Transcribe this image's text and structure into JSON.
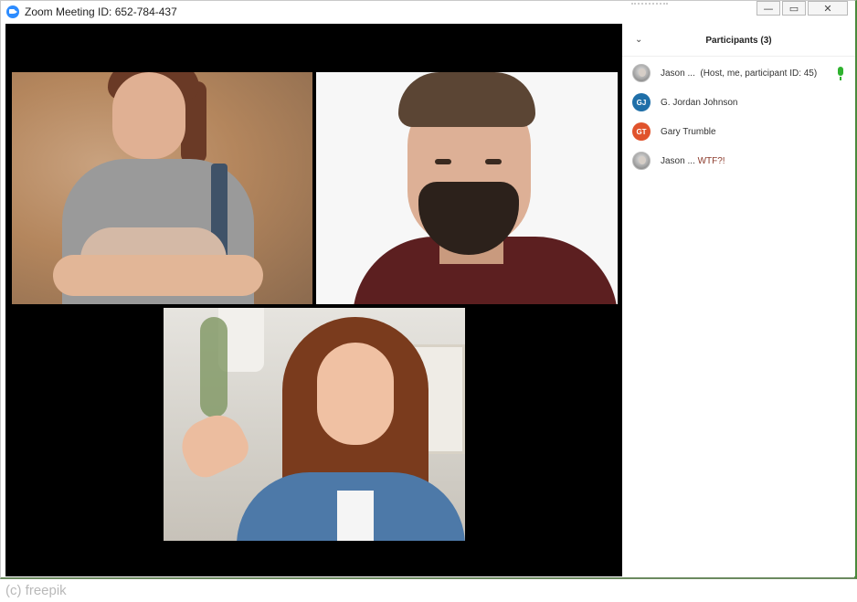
{
  "window": {
    "title": "Zoom Meeting ID: 652-784-437",
    "controls": {
      "minimize": "—",
      "restore": "▭",
      "close": "✕"
    }
  },
  "participants_panel": {
    "title": "Participants (3)",
    "items": [
      {
        "avatar": "photo",
        "name": "Jason ...",
        "detail": "(Host, me, participant ID: 45)",
        "mic": "mic-on-icon",
        "mic_color": "#2fb22f"
      },
      {
        "avatar": "GJ",
        "avatar_color": "#1f6fa8",
        "name": "G. Jordan Johnson",
        "detail": ""
      },
      {
        "avatar": "GT",
        "avatar_color": "#e0532c",
        "name": "Gary Trumble",
        "detail": ""
      },
      {
        "avatar": "photo",
        "name": "Jason ...",
        "detail": "WTF?!",
        "detail_color": "#8b3a2b"
      }
    ]
  },
  "video_tiles": [
    {
      "subject": "woman-breastfeeding"
    },
    {
      "subject": "bearded-man-frowning"
    },
    {
      "subject": "woman-confused"
    }
  ],
  "watermark": "(c) freepik",
  "colors": {
    "video_background": "#000000",
    "zoom_blue": "#2d8cff",
    "border_green": "#4a8a3c"
  }
}
